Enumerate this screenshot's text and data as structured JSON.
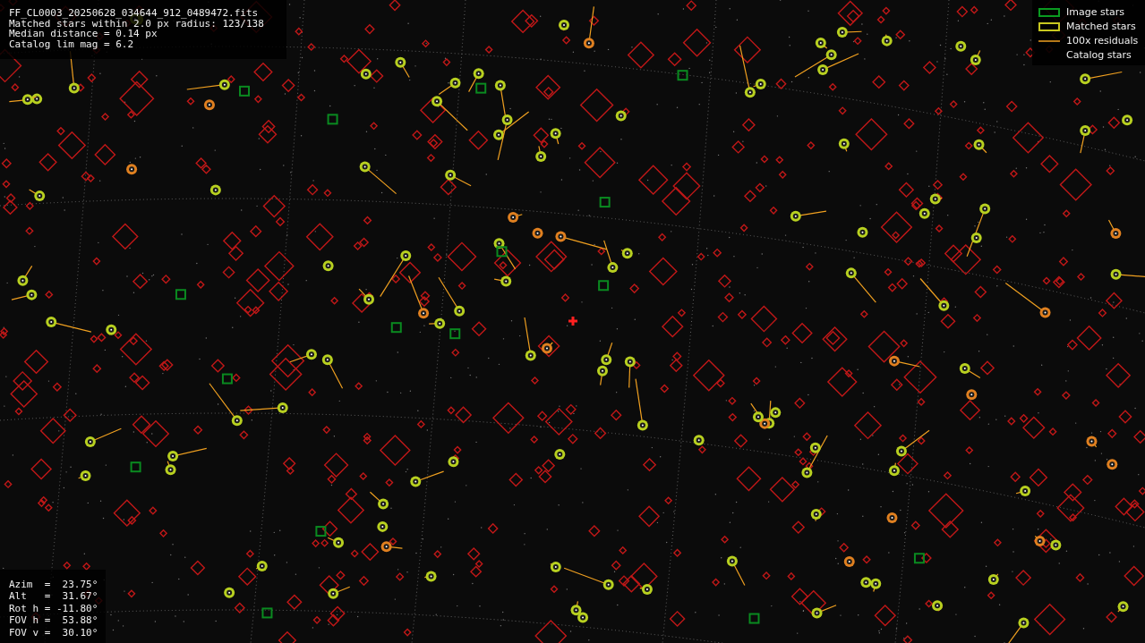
{
  "header": {
    "lines": [
      "FF_CL0003_20250628_034644_912_0489472.fits",
      "Matched stars within 2.0 px radius: 123/138",
      "Median distance = 0.14 px",
      "Catalog lim mag = 6.2"
    ]
  },
  "legend": [
    {
      "kind": "image",
      "label": "Image stars"
    },
    {
      "kind": "matched",
      "label": "Matched stars"
    },
    {
      "kind": "residual",
      "label": "100x residuals"
    },
    {
      "kind": "catalog",
      "label": "Catalog stars"
    }
  ],
  "pointing": {
    "lines": [
      "Azim  =  23.75°",
      "Alt   =  31.67°",
      "Rot h = -11.80°",
      "FOV h =  53.88°",
      "FOV v =  30.10°"
    ]
  }
}
